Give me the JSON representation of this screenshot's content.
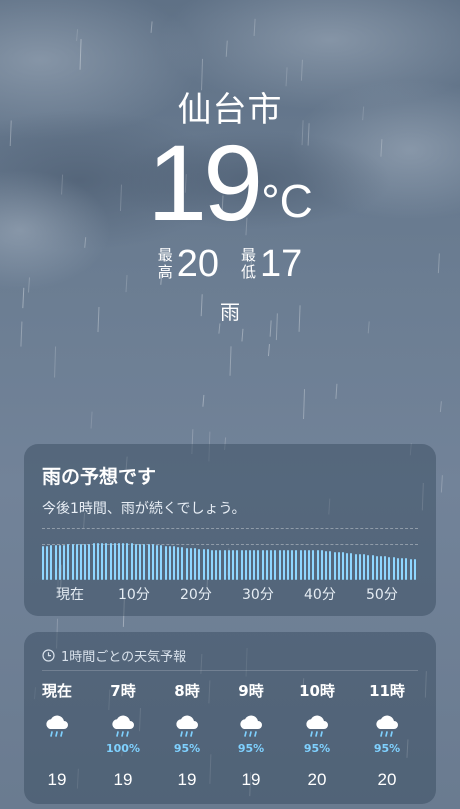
{
  "location": {
    "city": "仙台市",
    "temperature": "19",
    "unit": "°C",
    "high_label": "最高",
    "high": "20",
    "low_label": "最低",
    "low": "17",
    "condition": "雨"
  },
  "rain_forecast": {
    "title": "雨の予想です",
    "subtitle": "今後1時間、雨が続くでしょう。",
    "ticks": [
      "現在",
      "10分",
      "20分",
      "30分",
      "40分",
      "50分"
    ],
    "intensity": [
      0.86,
      0.86,
      0.87,
      0.87,
      0.88,
      0.88,
      0.89,
      0.89,
      0.9,
      0.9,
      0.91,
      0.91,
      0.92,
      0.92,
      0.92,
      0.93,
      0.93,
      0.93,
      0.93,
      0.93,
      0.92,
      0.92,
      0.91,
      0.91,
      0.9,
      0.9,
      0.89,
      0.88,
      0.87,
      0.86,
      0.85,
      0.84,
      0.83,
      0.82,
      0.81,
      0.8,
      0.79,
      0.78,
      0.77,
      0.77,
      0.76,
      0.76,
      0.76,
      0.76,
      0.75,
      0.75,
      0.75,
      0.75,
      0.75,
      0.75,
      0.75,
      0.76,
      0.76,
      0.76,
      0.76,
      0.76,
      0.76,
      0.76,
      0.76,
      0.76,
      0.76,
      0.76,
      0.76,
      0.76,
      0.75,
      0.75,
      0.74,
      0.73,
      0.72,
      0.71,
      0.7,
      0.69,
      0.68,
      0.67,
      0.66,
      0.65,
      0.64,
      0.63,
      0.62,
      0.61,
      0.6,
      0.59,
      0.58,
      0.57,
      0.56,
      0.55,
      0.54,
      0.53,
      0.52
    ],
    "color": "#8fd6ff"
  },
  "hourly": {
    "header": "1時間ごとの天気予報",
    "items": [
      {
        "time": "現在",
        "icon": "cloud-rain-icon",
        "pop": "",
        "temp": "19"
      },
      {
        "time": "7時",
        "icon": "cloud-rain-icon",
        "pop": "100%",
        "temp": "19"
      },
      {
        "time": "8時",
        "icon": "cloud-rain-icon",
        "pop": "95%",
        "temp": "19"
      },
      {
        "time": "9時",
        "icon": "cloud-rain-icon",
        "pop": "95%",
        "temp": "19"
      },
      {
        "time": "10時",
        "icon": "cloud-rain-icon",
        "pop": "95%",
        "temp": "20"
      },
      {
        "time": "11時",
        "icon": "cloud-rain-icon",
        "pop": "95%",
        "temp": "20"
      }
    ]
  },
  "colors": {
    "accent_rain": "#7fd1ff",
    "card_bg": "#34465c"
  }
}
